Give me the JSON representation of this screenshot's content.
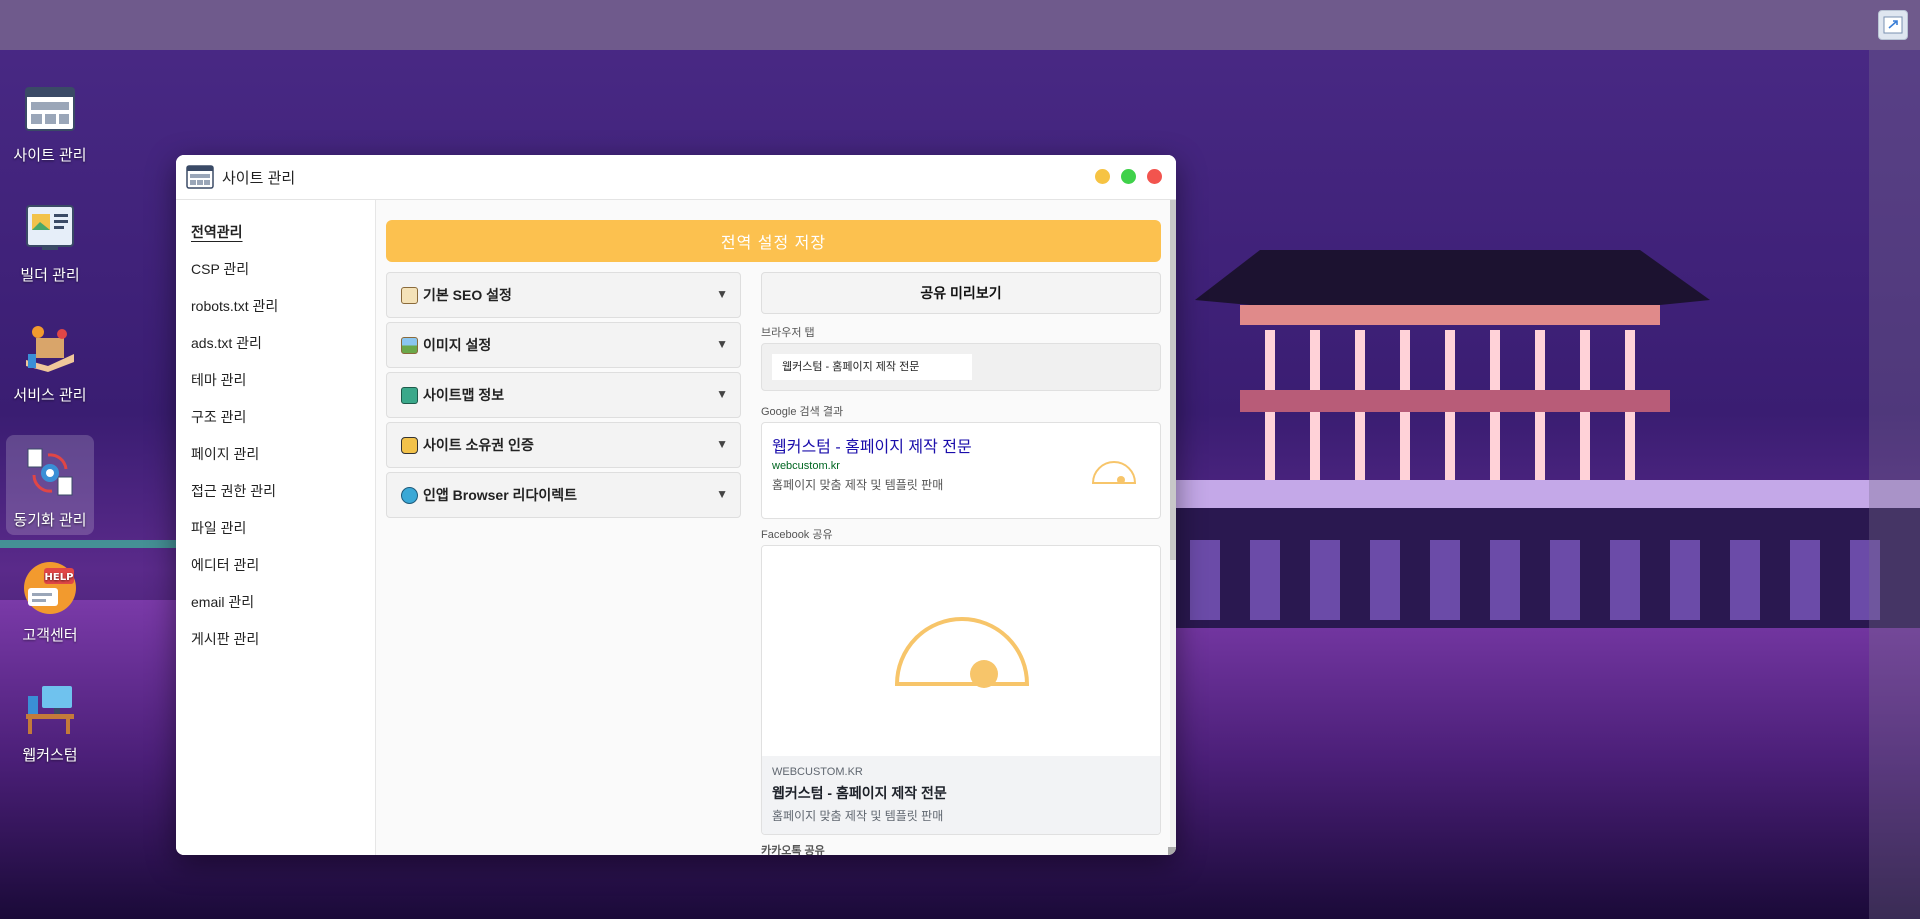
{
  "desktop": {
    "icons": [
      {
        "label": "사이트 관리",
        "icon": "site-management-icon"
      },
      {
        "label": "빌더 관리",
        "icon": "builder-icon"
      },
      {
        "label": "서비스 관리",
        "icon": "service-icon"
      },
      {
        "label": "동기화 관리",
        "icon": "sync-icon"
      },
      {
        "label": "고객센터",
        "icon": "help-icon"
      },
      {
        "label": "웹커스텀",
        "icon": "workstation-icon"
      }
    ]
  },
  "window": {
    "title": "사이트 관리",
    "controls": [
      "minimize",
      "maximize",
      "close"
    ]
  },
  "sidebar": {
    "items": [
      {
        "label": "전역관리",
        "active": true
      },
      {
        "label": "CSP 관리"
      },
      {
        "label": "robots.txt 관리"
      },
      {
        "label": "ads.txt 관리"
      },
      {
        "label": "테마 관리"
      },
      {
        "label": "구조 관리"
      },
      {
        "label": "페이지 관리"
      },
      {
        "label": "접근 권한 관리"
      },
      {
        "label": "파일 관리"
      },
      {
        "label": "에디터 관리"
      },
      {
        "label": "email 관리"
      },
      {
        "label": "게시판 관리"
      }
    ]
  },
  "main": {
    "save_label": "전역 설정 저장",
    "accordions": [
      {
        "label": "기본 SEO 설정",
        "icon": "memo-icon"
      },
      {
        "label": "이미지 설정",
        "icon": "picture-icon"
      },
      {
        "label": "사이트맵 정보",
        "icon": "map-icon"
      },
      {
        "label": "사이트 소유권 인증",
        "icon": "lock-icon"
      },
      {
        "label": "인앱 Browser 리다이렉트",
        "icon": "globe-icon"
      }
    ],
    "chevron": "▼"
  },
  "preview": {
    "header": "공유 미리보기",
    "browser_tab_label": "브라우저 탭",
    "browser_tab_text": "웹커스텀 - 홈페이지 제작 전문",
    "google_label": "Google 검색 결과",
    "google": {
      "title": "웹커스텀 - 홈페이지 제작 전문",
      "url": "webcustom.kr",
      "desc": "홈페이지 맞춤 제작 및 템플릿 판매"
    },
    "facebook_label": "Facebook 공유",
    "facebook": {
      "domain": "WEBCUSTOM.KR",
      "title": "웹커스텀 - 홈페이지 제작 전문",
      "desc": "홈페이지 맞춤 제작 및 템플릿 판매"
    },
    "kakao_label": "카카오톡 공유"
  },
  "colors": {
    "accent": "#fcc14f",
    "google_title": "#1a0dab",
    "google_url": "#006621"
  }
}
